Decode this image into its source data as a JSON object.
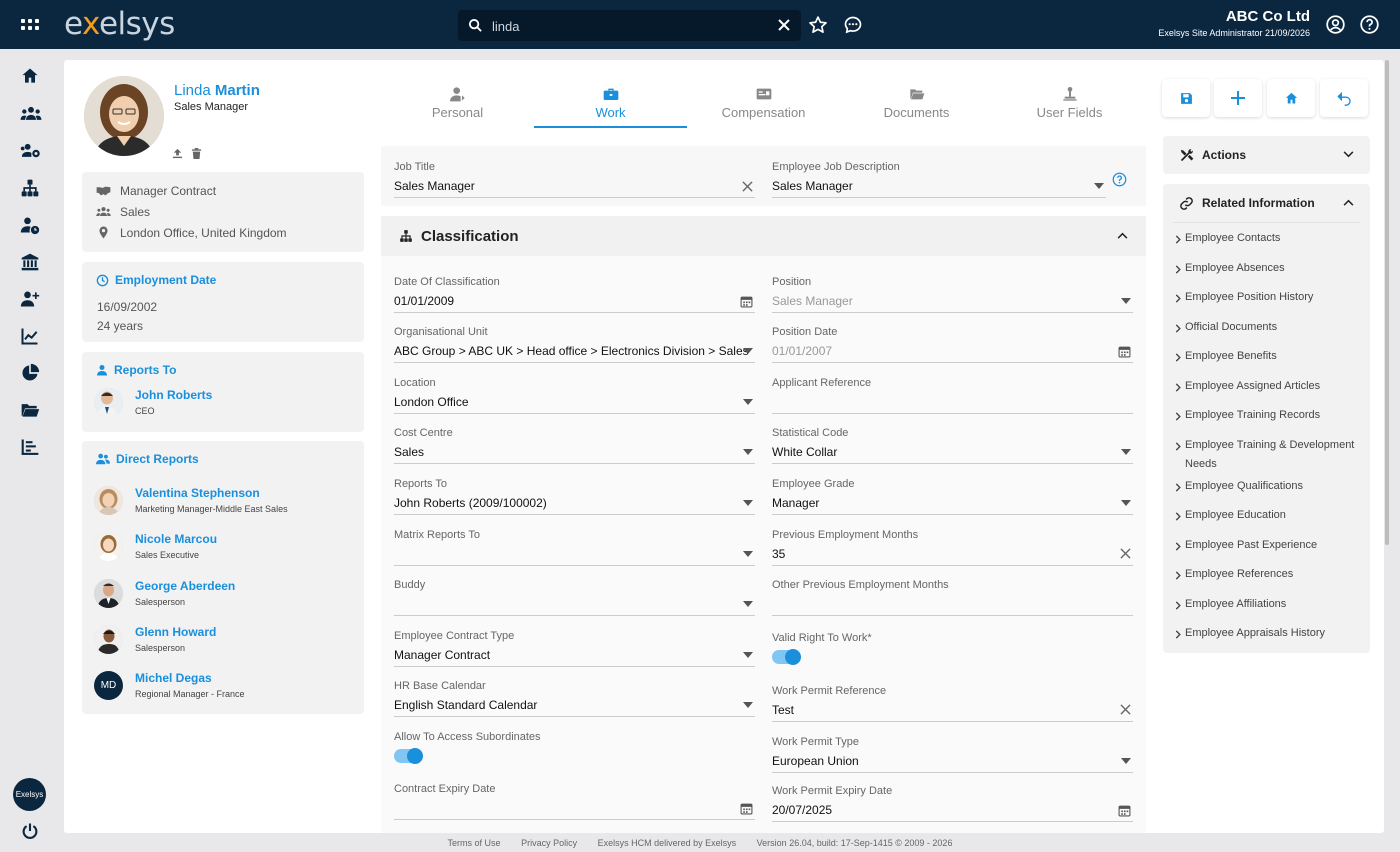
{
  "topbar": {
    "logo": {
      "pre": "e",
      "x": "x",
      "post": "elsys"
    },
    "search_value": "linda",
    "company": "ABC Co Ltd",
    "role": "Exelsys Site Administrator 21/09/2026"
  },
  "leftnav": {
    "icons": [
      "home-icon",
      "people-icon",
      "people-settings-icon",
      "org-chart-icon",
      "person-clock-icon",
      "bank-icon",
      "person-add-icon",
      "line-chart-icon",
      "pie-chart-icon",
      "folder-icon",
      "bar-list-icon"
    ],
    "badge": "Exelsys"
  },
  "employee": {
    "first_name": "Linda",
    "last_name": "Martin",
    "title": "Sales Manager",
    "contract": "Manager Contract",
    "department": "Sales",
    "location": "London Office, United Kingdom"
  },
  "employment": {
    "heading": "Employment Date",
    "date": "16/09/2002",
    "years": "24 years"
  },
  "reports_to": {
    "heading": "Reports To",
    "name": "John Roberts",
    "role": "CEO"
  },
  "direct_reports": {
    "heading": "Direct Reports",
    "people": [
      {
        "name": "Valentina Stephenson",
        "role": "Marketing Manager-Middle East Sales"
      },
      {
        "name": "Nicole Marcou",
        "role": "Sales Executive"
      },
      {
        "name": "George Aberdeen",
        "role": "Salesperson"
      },
      {
        "name": "Glenn Howard",
        "role": "Salesperson"
      },
      {
        "name": "Michel Degas",
        "role": "Regional Manager - France",
        "initials": "MD"
      }
    ]
  },
  "tabs": [
    {
      "label": "Personal",
      "icon": "person-icon"
    },
    {
      "label": "Work",
      "icon": "briefcase-icon",
      "active": true
    },
    {
      "label": "Compensation",
      "icon": "id-card-icon"
    },
    {
      "label": "Documents",
      "icon": "folder-icon"
    },
    {
      "label": "User Fields",
      "icon": "user-field-icon"
    }
  ],
  "top_fields": {
    "job_title": {
      "label": "Job Title",
      "value": "Sales Manager"
    },
    "job_description": {
      "label": "Employee Job Description",
      "value": "Sales Manager"
    }
  },
  "classification": {
    "heading": "Classification",
    "left": [
      {
        "label": "Date Of Classification",
        "value": "01/01/2009",
        "control": "calendar"
      },
      {
        "label": "Organisational Unit",
        "value": "ABC Group > ABC UK > Head office > Electronics Division > Sales",
        "control": "dropdown"
      },
      {
        "label": "Location",
        "value": "London Office",
        "control": "dropdown"
      },
      {
        "label": "Cost Centre",
        "value": "Sales",
        "control": "dropdown"
      },
      {
        "label": "Reports To",
        "value": "John Roberts (2009/100002)",
        "control": "dropdown"
      },
      {
        "label": "Matrix Reports To",
        "value": "",
        "control": "dropdown"
      },
      {
        "label": "Buddy",
        "value": "",
        "control": "dropdown"
      },
      {
        "label": "Employee Contract Type",
        "value": "Manager Contract",
        "control": "dropdown"
      },
      {
        "label": "HR Base Calendar",
        "value": "English Standard Calendar",
        "control": "dropdown"
      },
      {
        "label": "Allow To Access Subordinates",
        "value": "",
        "control": "toggle",
        "on": true
      },
      {
        "label": "Contract Expiry Date",
        "value": "",
        "control": "calendar"
      }
    ],
    "right": [
      {
        "label": "Position",
        "value": "Sales Manager",
        "control": "dropdown",
        "disabled": true
      },
      {
        "label": "Position Date",
        "value": "01/01/2007",
        "control": "calendar",
        "disabled": true
      },
      {
        "label": "Applicant Reference",
        "value": "",
        "control": "none"
      },
      {
        "label": "Statistical Code",
        "value": "White Collar",
        "control": "dropdown"
      },
      {
        "label": "Employee Grade",
        "value": "Manager",
        "control": "dropdown"
      },
      {
        "label": "Previous Employment Months",
        "value": "35",
        "control": "clear"
      },
      {
        "label": "Other Previous Employment Months",
        "value": "",
        "control": "none"
      },
      {
        "label": "Valid Right To Work*",
        "value": "",
        "control": "toggle",
        "on": true
      },
      {
        "label": "Work Permit Reference",
        "value": "Test",
        "control": "clear"
      },
      {
        "label": "Work Permit Type",
        "value": "European Union",
        "control": "dropdown"
      },
      {
        "label": "Work Permit Expiry Date",
        "value": "20/07/2025",
        "control": "calendar"
      }
    ]
  },
  "right_panel": {
    "actions": "Actions",
    "related": "Related Information",
    "links": [
      "Employee Contacts",
      "Employee Absences",
      "Employee Position History",
      "Official Documents",
      "Employee Benefits",
      "Employee Assigned Articles",
      "Employee Training Records",
      "Employee Training & Development Needs",
      "Employee Qualifications",
      "Employee Education",
      "Employee Past Experience",
      "Employee References",
      "Employee Affiliations",
      "Employee Appraisals History"
    ]
  },
  "footer": {
    "terms": "Terms of Use",
    "privacy": "Privacy Policy",
    "delivered": "Exelsys HCM delivered by Exelsys",
    "version": "Version 26.04, build: 17-Sep-1415 © 2009 - 2026"
  },
  "colors": {
    "accent": "#1a8fdc",
    "topbar": "#0b2740"
  }
}
